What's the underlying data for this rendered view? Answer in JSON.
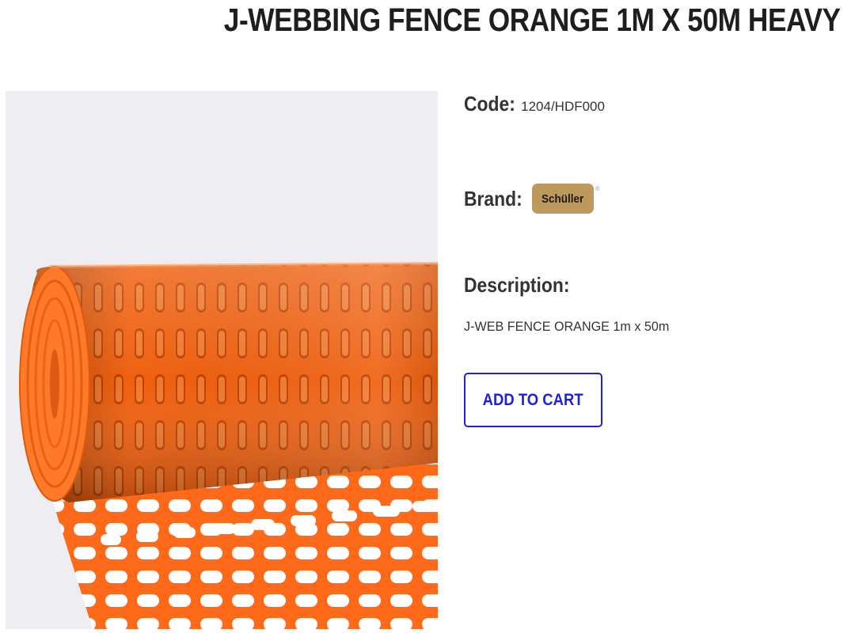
{
  "product": {
    "title": "J-WEBBING FENCE ORANGE 1M X 50M HEAVY",
    "code_label": "Code:",
    "code_value": "1204/HDF000",
    "brand_label": "Brand:",
    "brand_logo_text": "Schüller",
    "brand_logo_mark": "®",
    "description_label": "Description:",
    "description_text": "J-WEB FENCE ORANGE 1m x 50m",
    "add_to_cart_label": "ADD TO CART"
  },
  "image": {
    "subject": "orange-mesh-fence-roll",
    "background_color": "#eeeef2"
  },
  "colors": {
    "accent": "#1f1fe0",
    "mesh_orange": "#ff6a1a",
    "brand_gold": "#bd9a5c",
    "text": "#222222"
  }
}
